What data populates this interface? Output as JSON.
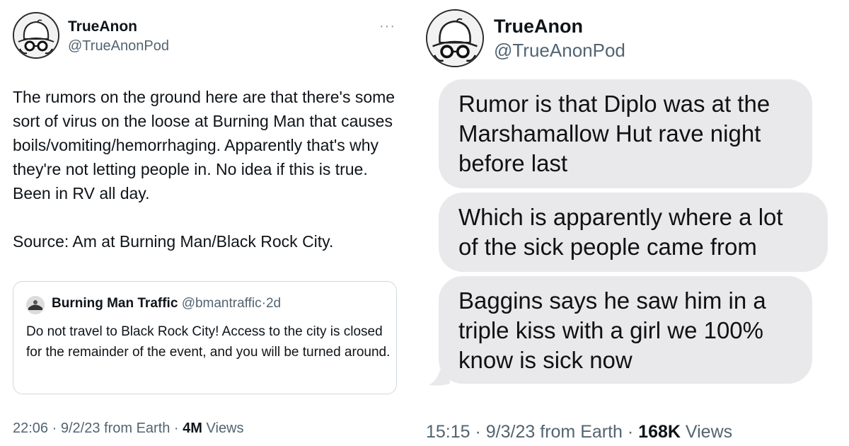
{
  "left_tweet": {
    "display_name": "TrueAnon",
    "handle": "@TrueAnonPod",
    "more_label": "···",
    "text": "The rumors on the ground here are that there's some sort of virus on the loose at Burning Man that causes boils/vomiting/hemorrhaging. Apparently that's why they're not letting people in. No idea if this is true. Been in RV all day.\n\nSource: Am at Burning Man/Black Rock City.",
    "quote": {
      "display_name": "Burning Man Traffic",
      "handle": "@bmantraffic",
      "separator": "·",
      "age": "2d",
      "text": "Do not travel to Black Rock City! Access to the city is closed for the remainder of the event, and you will be turned around."
    },
    "meta": {
      "time": "22:06",
      "date": "9/2/23",
      "source": "from Earth",
      "views_count": "4M",
      "views_label": "Views"
    }
  },
  "right_tweet": {
    "display_name": "TrueAnon",
    "handle": "@TrueAnonPod",
    "messages": [
      "Rumor is that Diplo was at the Marshamallow Hut rave night before last",
      "Which is apparently where a lot of the sick people came from",
      "Baggins says he saw him in a triple kiss with a girl we 100% know is sick now"
    ],
    "meta": {
      "time": "15:15",
      "date": "9/3/23",
      "source": "from Earth",
      "views_count": "168K",
      "views_label": "Views"
    }
  },
  "colors": {
    "text": "#0f1419",
    "secondary": "#536471",
    "border": "#cfd9de",
    "bubble": "#e9e9eb"
  },
  "icons": {
    "avatar": "bucket-hat-glasses-avatar",
    "quote_avatar": "burning-man-traffic-avatar",
    "more": "more-icon"
  }
}
